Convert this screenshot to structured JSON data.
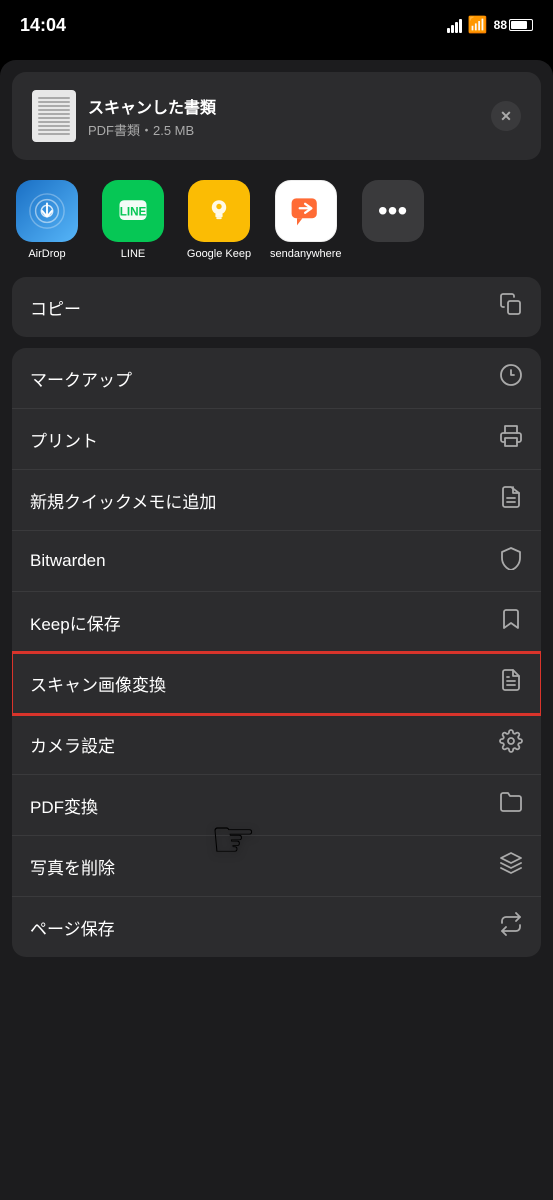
{
  "statusBar": {
    "time": "14:04",
    "battery": "88"
  },
  "fileHeader": {
    "name": "スキャンした書類",
    "meta": "PDF書類・2.5 MB",
    "closeLabel": "×"
  },
  "apps": [
    {
      "id": "airdrop",
      "label": "AirDrop",
      "icon": "airdrop"
    },
    {
      "id": "line",
      "label": "LINE",
      "icon": "line"
    },
    {
      "id": "googlekeep",
      "label": "Google Keep",
      "icon": "googlekeep"
    },
    {
      "id": "sendanywhere",
      "label": "sendanywhere",
      "icon": "sendanywhere"
    }
  ],
  "menuItems": [
    {
      "id": "copy",
      "label": "コピー",
      "icon": "copy",
      "section": 1
    },
    {
      "id": "markup",
      "label": "マークアップ",
      "icon": "markup",
      "section": 2
    },
    {
      "id": "print",
      "label": "プリント",
      "icon": "print",
      "section": 2
    },
    {
      "id": "quickmemo",
      "label": "新規クイックメモに追加",
      "icon": "quickmemo",
      "section": 2
    },
    {
      "id": "bitwarden",
      "label": "Bitwarden",
      "icon": "bitwarden",
      "section": 2
    },
    {
      "id": "keep",
      "label": "Keepに保存",
      "icon": "keep",
      "section": 2
    },
    {
      "id": "scanconvert",
      "label": "スキャン画像変換",
      "icon": "scanconvert",
      "section": 2,
      "highlighted": true
    },
    {
      "id": "camerasettings",
      "label": "カメラ設定",
      "icon": "camerasettings",
      "section": 2
    },
    {
      "id": "pdfconvert",
      "label": "PDF変換",
      "icon": "pdfconvert",
      "section": 2
    },
    {
      "id": "deletephoto",
      "label": "写真を削除",
      "icon": "deletephoto",
      "section": 2
    },
    {
      "id": "pagesave",
      "label": "ページ保存",
      "icon": "pagesave",
      "section": 2
    }
  ]
}
